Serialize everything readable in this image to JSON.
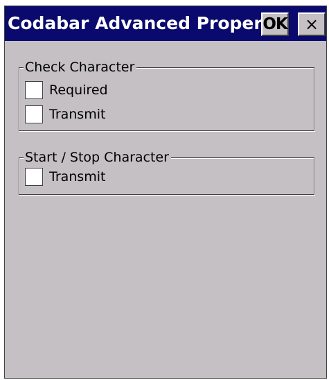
{
  "window": {
    "title": "Codabar Advanced Proper...",
    "ok_label": "OK",
    "close_label": "×"
  },
  "check_character": {
    "legend": "Check Character",
    "options": [
      {
        "label": "Required",
        "checked": false
      },
      {
        "label": "Transmit",
        "checked": false
      }
    ]
  },
  "start_stop_character": {
    "legend": "Start / Stop Character",
    "options": [
      {
        "label": "Transmit",
        "checked": false
      }
    ]
  },
  "colors": {
    "titlebar": "#0a0a6e",
    "face": "#c4c0c4",
    "title_text": "#ffffff"
  }
}
